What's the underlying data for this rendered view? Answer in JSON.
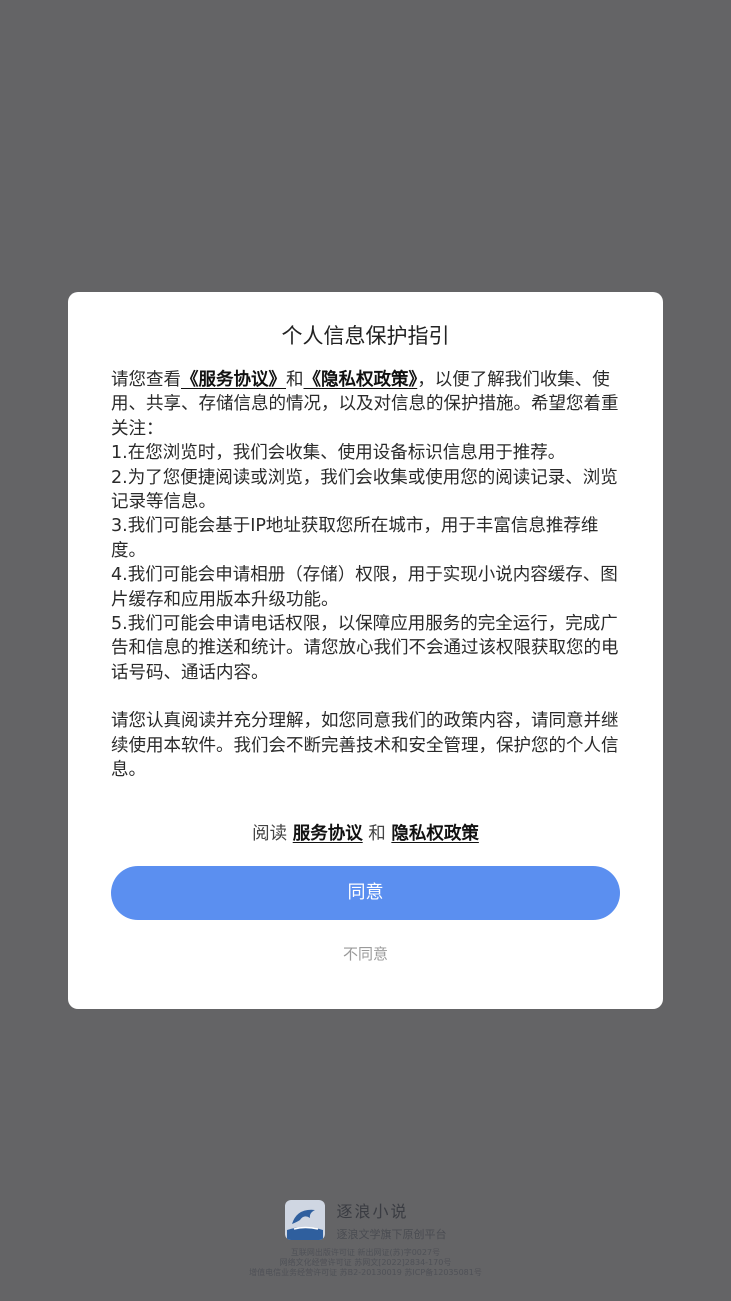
{
  "dialog": {
    "title": "个人信息保护指引",
    "intro_prefix": "请您查看",
    "service_link": "《服务协议》",
    "and": "和",
    "privacy_link": "《隐私权政策》",
    "intro_suffix": "，以便了解我们收集、使用、共享、存储信息的情况，以及对信息的保护措施。希望您着重关注：",
    "points": [
      "1.在您浏览时，我们会收集、使用设备标识信息用于推荐。",
      "2.为了您便捷阅读或浏览，我们会收集或使用您的阅读记录、浏览记录等信息。",
      "3.我们可能会基于IP地址获取您所在城市，用于丰富信息推荐维度。",
      "4.我们可能会申请相册（存储）权限，用于实现小说内容缓存、图片缓存和应用版本升级功能。",
      "5.我们可能会申请电话权限，以保障应用服务的完全运行，完成广告和信息的推送和统计。请您放心我们不会通过该权限获取您的电话号码、通话内容。"
    ],
    "closing": "请您认真阅读并充分理解，如您同意我们的政策内容，请同意并继续使用本软件。我们会不断完善技术和安全管理，保护您的个人信息。",
    "read_prefix": "阅读",
    "read_service": "服务协议",
    "read_and": "和",
    "read_privacy": "隐私权政策",
    "agree_label": "同意",
    "disagree_label": "不同意"
  },
  "footer": {
    "app_name": "逐浪小说",
    "slogan": "逐浪文学旗下原创平台",
    "license_lines": [
      "互联网出版许可证 新出网证(苏)字0027号",
      "网络文化经营许可证 苏网文[2022]2834-170号",
      "增值电信业务经营许可证 苏B2-20130019   苏ICP备12035081号"
    ]
  },
  "colors": {
    "backdrop": "#646466",
    "accent": "#5b8ff0"
  }
}
